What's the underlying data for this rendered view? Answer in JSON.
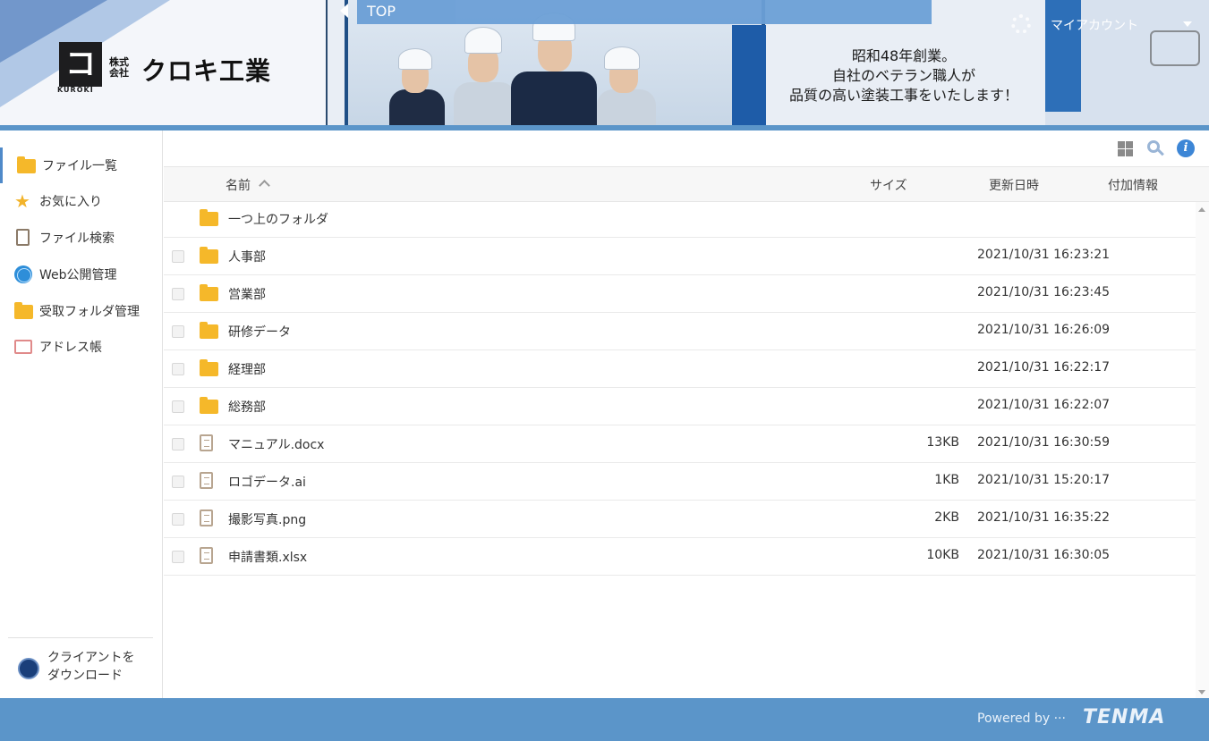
{
  "header": {
    "company_prefix": "株式\n会社",
    "company_name": "クロキ工業",
    "logo_sub": "KUROKI",
    "breadcrumb": "TOP",
    "slogan_lines": [
      "昭和48年創業。",
      "自社のベテラン職人が",
      "品質の高い塗装工事をいたします！"
    ],
    "account_label": "マイアカウント"
  },
  "sidebar": {
    "items": [
      {
        "label": "ファイル一覧",
        "icon": "folder-icon",
        "active": true
      },
      {
        "label": "お気に入り",
        "icon": "star-icon"
      },
      {
        "label": "ファイル検索",
        "icon": "file-search-icon"
      },
      {
        "label": "Web公開管理",
        "icon": "globe-icon"
      },
      {
        "label": "受取フォルダ管理",
        "icon": "receive-folder-icon"
      },
      {
        "label": "アドレス帳",
        "icon": "address-book-icon"
      }
    ],
    "client_download": "クライアントを\nダウンロード"
  },
  "table": {
    "headers": {
      "name": "名前",
      "size": "サイズ",
      "modified": "更新日時",
      "extra": "付加情報"
    },
    "parent_folder": "一つ上のフォルダ",
    "rows": [
      {
        "name": "人事部",
        "type": "folder",
        "size": "",
        "date": "2021/10/31 16:23:21"
      },
      {
        "name": "営業部",
        "type": "folder",
        "size": "",
        "date": "2021/10/31 16:23:45"
      },
      {
        "name": "研修データ",
        "type": "folder",
        "size": "",
        "date": "2021/10/31 16:26:09"
      },
      {
        "name": "経理部",
        "type": "folder",
        "size": "",
        "date": "2021/10/31 16:22:17"
      },
      {
        "name": "総務部",
        "type": "folder",
        "size": "",
        "date": "2021/10/31 16:22:07"
      },
      {
        "name": "マニュアル.docx",
        "type": "file",
        "size": "13KB",
        "date": "2021/10/31 16:30:59"
      },
      {
        "name": "ロゴデータ.ai",
        "type": "file",
        "size": "1KB",
        "date": "2021/10/31 15:20:17"
      },
      {
        "name": "撮影写真.png",
        "type": "file",
        "size": "2KB",
        "date": "2021/10/31 16:35:22"
      },
      {
        "name": "申請書類.xlsx",
        "type": "file",
        "size": "10KB",
        "date": "2021/10/31 16:30:05"
      }
    ]
  },
  "footer": {
    "powered_by": "Powered by ···",
    "brand": "TENMA"
  },
  "colors": {
    "accent": "#5b95c9",
    "folder": "#f5b82a",
    "info": "#3d86d6"
  }
}
